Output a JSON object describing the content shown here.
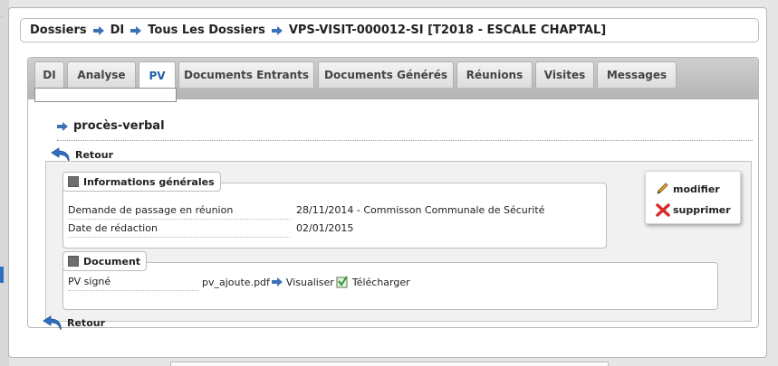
{
  "breadcrumb": {
    "items": [
      "Dossiers",
      "DI",
      "Tous Les Dossiers",
      "VPS-VISIT-000012-SI [T2018 - ESCALE CHAPTAL]"
    ],
    "separator_icon": "arrow-right-icon"
  },
  "tabs": [
    {
      "label": "DI",
      "active": false
    },
    {
      "label": "Analyse",
      "active": false
    },
    {
      "label": "PV",
      "active": true
    },
    {
      "label": "Documents Entrants",
      "active": false
    },
    {
      "label": "Documents Générés",
      "active": false
    },
    {
      "label": "Réunions",
      "active": false
    },
    {
      "label": "Visites",
      "active": false
    },
    {
      "label": "Messages",
      "active": false
    }
  ],
  "tab_search": {
    "value": "",
    "placeholder": ""
  },
  "section": {
    "title": "procès-verbal"
  },
  "retour_label": "Retour",
  "actions": {
    "modifier": "modifier",
    "supprimer": "supprimer"
  },
  "info_generales": {
    "legend": "Informations générales",
    "rows": [
      {
        "label": "Demande de passage en réunion",
        "value": "28/11/2014 - Commisson Communale de Sécurité"
      },
      {
        "label": "Date de rédaction",
        "value": "02/01/2015"
      }
    ]
  },
  "document": {
    "legend": "Document",
    "label": "PV signé",
    "filename": "pv_ajoute.pdf",
    "visualiser": "Visualiser",
    "telecharger": "Télécharger"
  },
  "colors": {
    "accent": "#1f5fa8",
    "arrow": "#3b73b9",
    "delete": "#d62b2b"
  }
}
